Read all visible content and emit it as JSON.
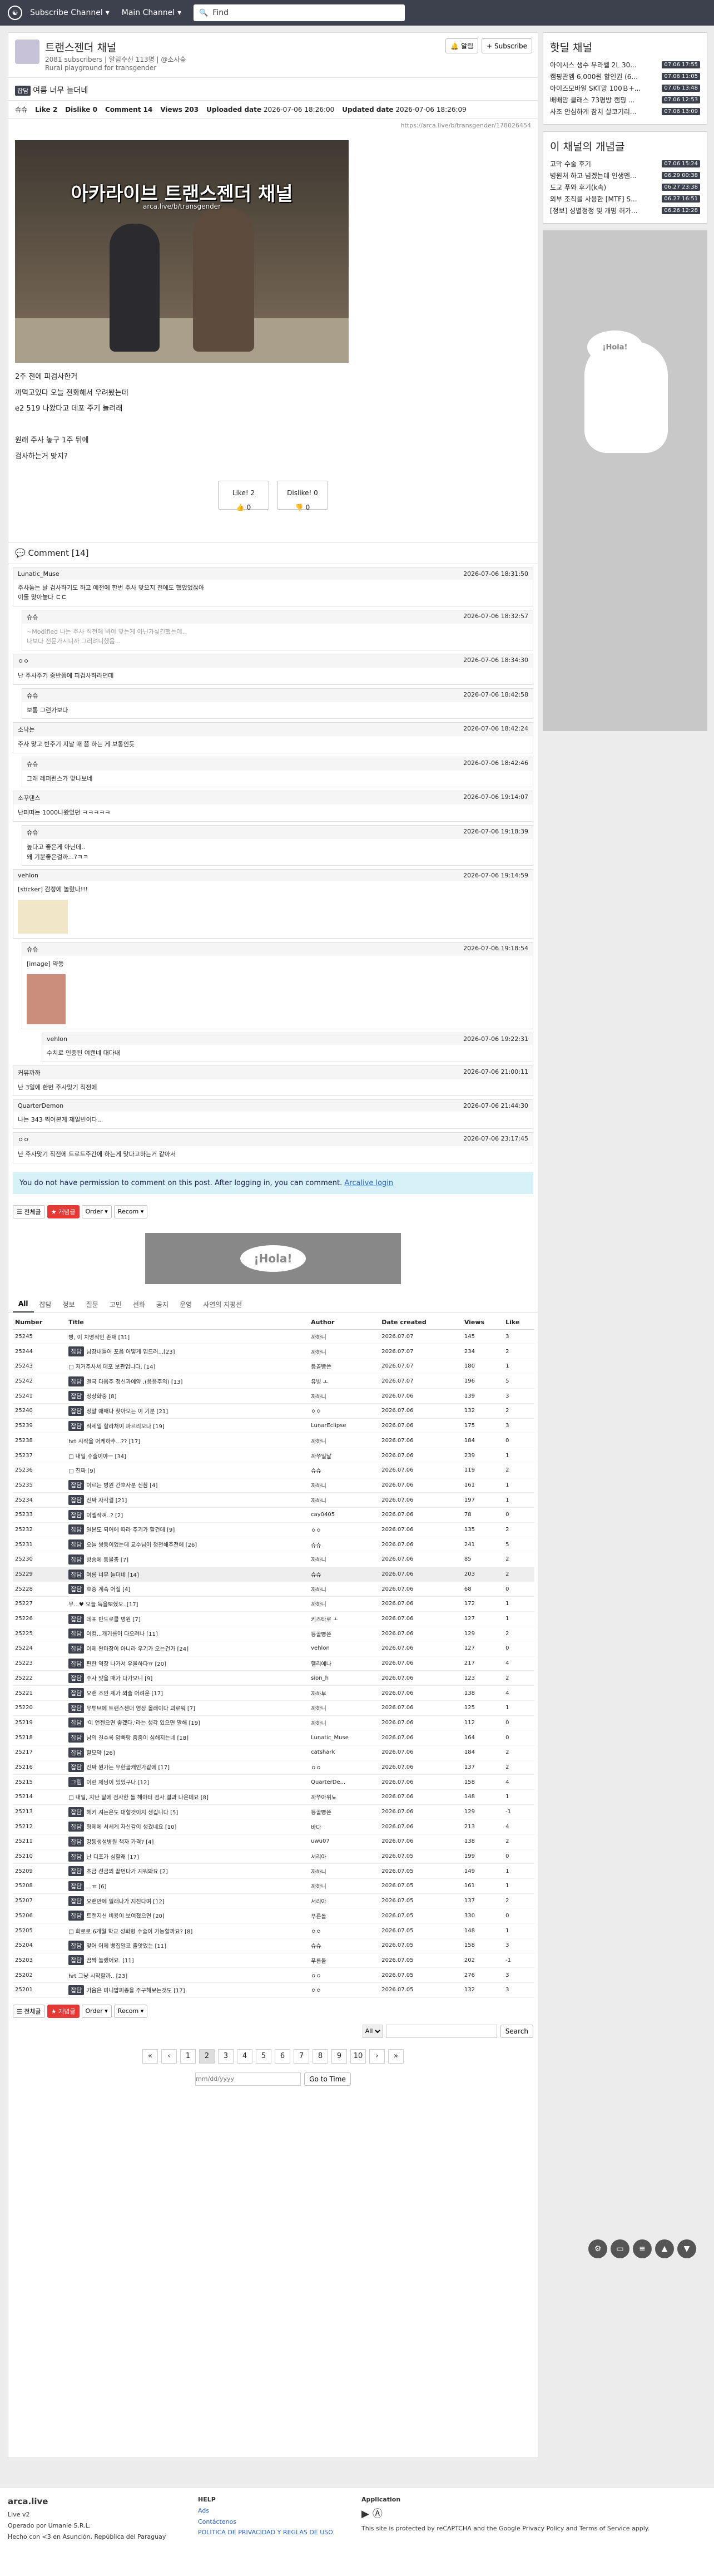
{
  "nav": {
    "subscribe": "Subscribe Channel",
    "main": "Main Channel",
    "search_placeholder": "Find"
  },
  "channel": {
    "title": "트랜스젠더 채널",
    "stats": "2081 subscribers | 알림수신 113명 | @소사숲",
    "subtitle": "Rural playground for transgender",
    "notify": "알림",
    "subscribe": "+ Subscribe"
  },
  "post": {
    "tag": "잡담",
    "title": "여름 너무 늘더네",
    "author": "슈슈",
    "like": "Like 2",
    "dislike": "Dislike 0",
    "comment": "Comment 14",
    "views": "Views 203",
    "uploaded_label": "Uploaded date",
    "uploaded": "2026-07-06 18:26:00",
    "updated_label": "Updated date",
    "updated": "2026-07-06 18:26:09",
    "url": "https://arca.live/b/transgender/178026454",
    "img_title": "아카라이브 트랜스젠더 채널",
    "img_sub": "arca.live/b/transgender",
    "lines": [
      "2주 전에 피검사한거",
      "까먹고있다 오늘 전화해서 우려봤는데",
      "e2 519 나왔다고 데포 주기 늘려래",
      "",
      "원래 주사 놓구 1주 뒤에",
      "검사하는거 맞지?"
    ],
    "like_btn": "Like! 2",
    "like_sub": "0",
    "dislike_btn": "Dislike! 0",
    "dislike_sub": "0"
  },
  "comments_header": "Comment [14]",
  "comments": [
    {
      "lvl": 0,
      "user": "Lunatic_Muse",
      "time": "2026-07-06 18:31:50",
      "text": "주사놓는 날 검사하기도 하고 예전에 한번 주사 맞으지 전에도 했었었잖아\n이둘 맞아놓다 ㄷㄷ"
    },
    {
      "lvl": 1,
      "user": "슈슈",
      "time": "2026-07-06 18:32:57",
      "text": "~Modified 나는 주사 직전에 봐야 맞는게 아닌가싶긴했는데..\n나보다 전문가시니까 그러려니했음...",
      "del": true
    },
    {
      "lvl": 0,
      "user": "ㅇㅇ",
      "time": "2026-07-06 18:34:30",
      "text": "난 주사주기 중반쯤에 피검사하라던데"
    },
    {
      "lvl": 1,
      "user": "슈슈",
      "time": "2026-07-06 18:42:58",
      "text": "보통 그런가보다"
    },
    {
      "lvl": 0,
      "user": "소낙는",
      "time": "2026-07-06 18:42:24",
      "text": "주사 맞고 반주기 지날 때 쯤 하는 게 보통인듯"
    },
    {
      "lvl": 1,
      "user": "슈슈",
      "time": "2026-07-06 18:42:46",
      "text": "그래 레퍼런스가 맞나보네"
    },
    {
      "lvl": 0,
      "user": "소꾸댄스",
      "time": "2026-07-06 19:14:07",
      "text": "난피떠는 1000나왔었던 ㅋㅋㅋㅋㅋ"
    },
    {
      "lvl": 1,
      "user": "슈슈",
      "time": "2026-07-06 19:18:39",
      "text": "높다고 좋은게 아닌데..\n왜 기분좋은걸까...?ㅋㅋ"
    },
    {
      "lvl": 0,
      "user": "vehlon",
      "time": "2026-07-06 19:14:59",
      "text": "[sticker] 감정에 놀랐나!!!",
      "img": "sticker"
    },
    {
      "lvl": 1,
      "user": "슈슈",
      "time": "2026-07-06 19:18:54",
      "text": "[image] 약쭝",
      "img": "photo"
    },
    {
      "lvl": 2,
      "user": "vehlon",
      "time": "2026-07-06 19:22:31",
      "text": "수치로 인증된 여캔네 대다내"
    },
    {
      "lvl": 0,
      "user": "커뮤까까",
      "time": "2026-07-06 21:00:11",
      "text": "난 3일에 한번 주사맞기 직전에"
    },
    {
      "lvl": 0,
      "user": "QuarterDemon",
      "time": "2026-07-06 21:44:30",
      "text": "나는 343 찍어본게 제일빈이다..."
    },
    {
      "lvl": 0,
      "user": "ㅇㅇ",
      "time": "2026-07-06 23:17:45",
      "text": "난 주사맞기 직전에 트로트주간에 하는게 맞다고하는거 같아서"
    }
  ],
  "notice": "You do not have permission to comment on this post. After logging in, you can comment.",
  "notice_link": "Arcalive login",
  "tools": {
    "all": "전체글",
    "best": "개념글",
    "order": "Order",
    "recom": "Recom"
  },
  "ad_text": "¡Hola!",
  "tabs": [
    "All",
    "잡담",
    "정보",
    "질문",
    "고민",
    "선화",
    "공지",
    "운영",
    "사연의 지평선"
  ],
  "table_headers": [
    "Number",
    "Title",
    "Author",
    "Date created",
    "Views",
    "Like"
  ],
  "rows": [
    [
      "25245",
      "",
      "빵, 이 치명적인 존재 [31]",
      "까하니",
      "2026.07.07",
      "145",
      "3"
    ],
    [
      "25244",
      "잡담",
      "남장내들어 포읍 어떻게 입드러...[23]",
      "까하니",
      "2026.07.07",
      "234",
      "2"
    ],
    [
      "25243",
      "",
      "□ 저거주사서 데포 보관업니다. [14]",
      "등골빵쓴",
      "2026.07.07",
      "180",
      "1"
    ],
    [
      "25242",
      "잡담",
      "결국 다음주 정신과예약 .(응응주의) [13]",
      "유빙 ㅗ",
      "2026.07.07",
      "196",
      "5"
    ],
    [
      "25241",
      "잡담",
      "정상화중 [8]",
      "까하니",
      "2026.07.06",
      "139",
      "3"
    ],
    [
      "25240",
      "잡담",
      "정말 애매다 찾아오는 이 기분 [21]",
      "ㅇㅇ",
      "2026.07.06",
      "132",
      "2"
    ],
    [
      "25239",
      "잡담",
      "작세밀 할라처이 파르리오나 [19]",
      "LunarEclipse",
      "2026.07.06",
      "175",
      "3"
    ],
    [
      "25238",
      "",
      "hrt 시작을 어케하추...?? [17]",
      "까하니",
      "2026.07.06",
      "184",
      "0"
    ],
    [
      "25237",
      "",
      "□ 내일 수술이야ㅡ [34]",
      "까쭈일날",
      "2026.07.06",
      "239",
      "1"
    ],
    [
      "25236",
      "",
      "□ 진짜 [9]",
      "슈슈",
      "2026.07.06",
      "119",
      "2"
    ],
    [
      "25235",
      "잡담",
      "이르는 병원 간호사분 신참 [4]",
      "까하니",
      "2026.07.06",
      "161",
      "1"
    ],
    [
      "25234",
      "잡담",
      "진짜 자각결 [21]",
      "까하니",
      "2026.07.06",
      "197",
      "1"
    ],
    [
      "25233",
      "잡담",
      "이엘작껴..? [2]",
      "cay0405",
      "2026.07.06",
      "78",
      "0"
    ],
    [
      "25232",
      "잡담",
      "일본도 되어에 따라 주기가 할건데 [9]",
      "ㅇㅇ",
      "2026.07.06",
      "135",
      "2"
    ],
    [
      "25231",
      "잡담",
      "오늘 쌍둥이었는데 교수님이 청천해주전에 [26]",
      "슈슈",
      "2026.07.06",
      "241",
      "5"
    ],
    [
      "25230",
      "잡담",
      "방송에 동물총 [7]",
      "까하니",
      "2026.07.06",
      "85",
      "2"
    ],
    [
      "25229",
      "잡담",
      "여름 너무 늘더네 [14]",
      "슈슈",
      "2026.07.06",
      "203",
      "2"
    ],
    [
      "25228",
      "잡담",
      "효증 계속 어질 [4]",
      "까하니",
      "2026.07.06",
      "68",
      "0"
    ],
    [
      "25227",
      "",
      "무...♥ 오늘 득을뽀했오..[17]",
      "까하니",
      "2026.07.06",
      "172",
      "1"
    ],
    [
      "25226",
      "잡담",
      "데포 반드로콜 병원 [7]",
      "키즈타로 ㅗ",
      "2026.07.06",
      "127",
      "1"
    ],
    [
      "25225",
      "잡담",
      "이컴...개기름이 다오려나 [11]",
      "등골빵쓴",
      "2026.07.06",
      "129",
      "2"
    ],
    [
      "25224",
      "잡담",
      "이제 완마장이 아니라 우기가 오는건가 [24]",
      "vehlon",
      "2026.07.06",
      "127",
      "0"
    ],
    [
      "25223",
      "잡담",
      "편한 역장 나가서 우울하다ㅠ [20]",
      "헬리에나",
      "2026.07.06",
      "217",
      "4"
    ],
    [
      "25222",
      "잡담",
      "주사 맞을 때가 다가오니 [9]",
      "sion_h",
      "2026.07.06",
      "123",
      "2"
    ],
    [
      "25221",
      "잡담",
      "오랜 조인 제가 외출 어려운 [17]",
      "까하부",
      "2026.07.06",
      "138",
      "4"
    ],
    [
      "25220",
      "잡담",
      "유튜브에 트랜스젠더 영상 올래이다 괴로워 [7]",
      "까하니",
      "2026.07.06",
      "125",
      "1"
    ],
    [
      "25219",
      "잡담",
      "'이 언젠으면 좋겠다.'라는 생각 있으면 말해 [19]",
      "까하니",
      "2026.07.06",
      "112",
      "0"
    ],
    [
      "25218",
      "잡담",
      "남의 길수록 암빠랑 줌줌이 심해지는네 [18]",
      "Lunatic_Muse",
      "2026.07.06",
      "164",
      "0"
    ],
    [
      "25217",
      "잡담",
      "할모약 [26]",
      "catshark",
      "2026.07.06",
      "184",
      "2"
    ],
    [
      "25216",
      "잡담",
      "진짜 뭔가는 우한골캐인가같에 [17]",
      "ㅇㅇ",
      "2026.07.06",
      "137",
      "2"
    ],
    [
      "25215",
      "그림",
      "이런 제닝이 있었구나 [12]",
      "QuarterDe...",
      "2026.07.06",
      "158",
      "4"
    ],
    [
      "25214",
      "",
      "□ 내일, 지난 달에 검사한 돌 해야터 검사 결과 나온데요 [8]",
      "까쭈아위뇨",
      "2026.07.06",
      "148",
      "1"
    ],
    [
      "25213",
      "잡담",
      "헤키 셔는은도 대할것이지 생깁니다 [5]",
      "등골빵쓴",
      "2026.07.06",
      "129",
      "-1"
    ],
    [
      "25212",
      "잡담",
      "형제에 셔세계 자신감이 생겼네요 [10]",
      "바다",
      "2026.07.06",
      "213",
      "4"
    ],
    [
      "25211",
      "잡담",
      "강동생설병원 책자 가격? [4]",
      "uwu07",
      "2026.07.06",
      "138",
      "2"
    ],
    [
      "25210",
      "잡담",
      "난 디포가 심할래 [17]",
      "서리아",
      "2026.07.05",
      "199",
      "0"
    ],
    [
      "25209",
      "잡담",
      "초금 선금의 끝번다가 지워봐요 [2]",
      "까하니",
      "2026.07.05",
      "149",
      "1"
    ],
    [
      "25208",
      "잡담",
      "...ㅠ [6]",
      "까하니",
      "2026.07.05",
      "161",
      "1"
    ],
    [
      "25207",
      "잡담",
      "오랜만에 일래나가 지진다며 [12]",
      "서리아",
      "2026.07.05",
      "137",
      "2"
    ],
    [
      "25206",
      "잡담",
      "트랜지션 비용이 보여졌으면 [20]",
      "푸른돌",
      "2026.07.05",
      "330",
      "0"
    ],
    [
      "25205",
      "",
      "□ 회로로 6개월 학교 성화형 수술이 가능할까요? [8]",
      "ㅇㅇ",
      "2026.07.05",
      "148",
      "1"
    ],
    [
      "25204",
      "잡담",
      "맞어 어제 빵집알코 출앗었는 [11]",
      "슈슈",
      "2026.07.05",
      "158",
      "3"
    ],
    [
      "25203",
      "잡담",
      "끔짝 놀랬어요. [11]",
      "푸른돌",
      "2026.07.05",
      "202",
      "-1"
    ],
    [
      "25202",
      "",
      "hrt 그냥 시작할까.. [23]",
      "ㅇㅇ",
      "2026.07.05",
      "276",
      "3"
    ],
    [
      "25201",
      "잡담",
      "가음은 미니밥피종을 주구해보는것도 [17]",
      "ㅇㅇ",
      "2026.07.05",
      "132",
      "3"
    ]
  ],
  "pages": [
    "«",
    "‹",
    "1",
    "2",
    "3",
    "4",
    "5",
    "6",
    "7",
    "8",
    "9",
    "10",
    "›",
    "»"
  ],
  "current_page": "2",
  "bottom": {
    "select": "All",
    "search_btn": "Search",
    "date_placeholder": "mm/dd/yyyy",
    "goto": "Go to Time"
  },
  "side": {
    "hot_title": "핫딜 채널",
    "hot": [
      [
        "아이시스 생수 무라벨 2L 30...",
        "07.06 17:55"
      ],
      [
        "캠핑관엠 6,000원 할인권 (6...",
        "07.06 11:05"
      ],
      [
        "아이즈모바일 SKT망 100Ｂ+...",
        "07.06 13:48"
      ],
      [
        "배배맘 클래스 73평방 캠핑 ...",
        "07.06 12:53"
      ],
      [
        "사조 안심하게 참치 살코기리...",
        "07.06 13:09"
      ]
    ],
    "best_title": "이 채널의 개념글",
    "best": [
      [
        "고막 수술 후기",
        "07.06 15:24"
      ],
      [
        "병원처 하고 넘겠는데 인생엔...",
        "06.29 00:38"
      ],
      [
        "도교 푸와 후기(k속)",
        "06.27 23:38"
      ],
      [
        "외부 조직을 사용한 [MTF] S...",
        "06.27 16:51"
      ],
      [
        "[정보] 성별정정 및 개명 허가...",
        "06.26 12:28"
      ]
    ],
    "ad": "¡Hola!"
  },
  "footer": {
    "brand": "arca.live",
    "version": "Live v2",
    "company": "Operado por Umanle S.R.L.",
    "addr": "Hecho con <3 en Asunción, República del Paraguay",
    "help": "HELP",
    "ads": "Ads",
    "contact": "Contáctenos",
    "policy": "POLITICA DE PRIVACIDAD Y REGLAS DE USO",
    "app": "Application",
    "recaptcha": "This site is protected by reCAPTCHA and the Google Privacy Policy and Terms of Service apply."
  }
}
